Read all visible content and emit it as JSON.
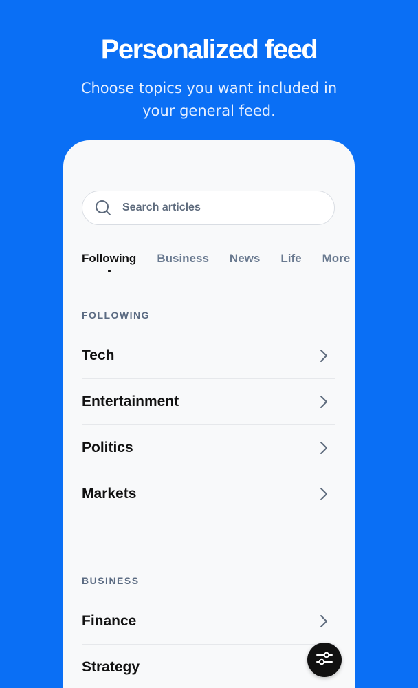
{
  "header": {
    "title": "Personalized feed",
    "subtitle": "Choose topics you want included in your general feed."
  },
  "search": {
    "placeholder": "Search articles",
    "icon": "search-icon"
  },
  "tabs": [
    {
      "label": "Following",
      "active": true
    },
    {
      "label": "Business",
      "active": false
    },
    {
      "label": "News",
      "active": false
    },
    {
      "label": "Life",
      "active": false
    },
    {
      "label": "More",
      "active": false
    }
  ],
  "sections": {
    "following": {
      "label": "FOLLOWING",
      "items": [
        {
          "label": "Tech"
        },
        {
          "label": "Entertainment"
        },
        {
          "label": "Politics"
        },
        {
          "label": "Markets"
        }
      ]
    },
    "business": {
      "label": "BUSINESS",
      "items": [
        {
          "label": "Finance"
        },
        {
          "label": "Strategy"
        }
      ]
    }
  },
  "fab": {
    "icon": "sliders-icon"
  },
  "colors": {
    "background": "#0a6ff5",
    "card": "#f8f9fa",
    "text_primary": "#111111",
    "text_muted": "#6a7a90"
  }
}
